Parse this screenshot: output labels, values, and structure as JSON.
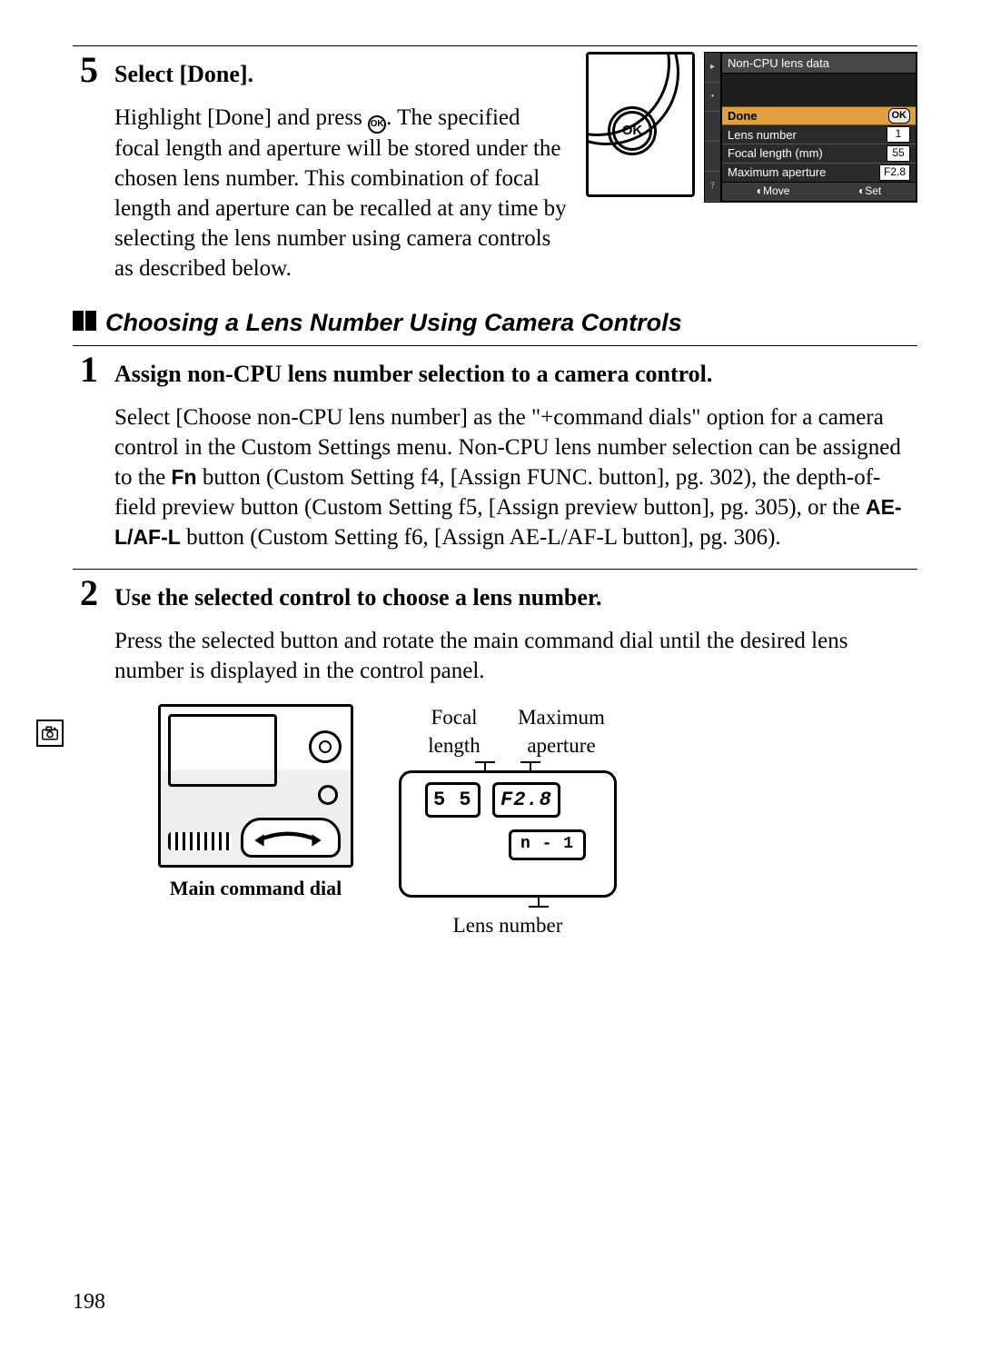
{
  "page_number": "198",
  "step5": {
    "num": "5",
    "title": "Select [Done].",
    "text_before_icon": "Highlight [Done] and press ",
    "text_after_icon": ". The specified focal length and aperture will be stored under the chosen lens number.  This combination of focal length and aperture can be recalled at any time by selecting the lens number using camera controls as described below.",
    "ok_btn_label": "OK"
  },
  "lcd": {
    "title": "Non-CPU lens data",
    "rows": {
      "done": "Done",
      "done_ok": "OK",
      "lens_number_label": "Lens number",
      "lens_number_val": "1",
      "focal_label": "Focal length (mm)",
      "focal_val": "55",
      "aperture_label": "Maximum aperture",
      "aperture_val": "F2.8"
    },
    "foot_move": "Move",
    "foot_set": "Set",
    "side_icons": [
      "▸",
      "•",
      "",
      "",
      "?"
    ]
  },
  "subheading": "Choosing a Lens Number Using Camera Controls",
  "step1": {
    "num": "1",
    "title": "Assign non-CPU lens number selection to a camera control.",
    "text1": "Select [Choose non-CPU lens number] as the \"+command dials\" option for a camera control in the Custom Settings menu.  Non-CPU lens number selection can be assigned to the ",
    "fn": "Fn",
    "text2": " button (Custom Setting f4, [Assign FUNC.  button], pg. 302), the depth-of-field preview button (Custom Setting f5, [Assign preview button], pg. 305), or the ",
    "ael": "AE-L/AF-L",
    "text3": " button (Custom Setting f6, [Assign AE-L/AF-L button], pg. 306)."
  },
  "step2": {
    "num": "2",
    "title": "Use the selected control to choose a lens number.",
    "text": "Press the selected button and rotate the main command dial until the desired lens number is displayed in the control panel."
  },
  "bottom": {
    "main_dial": "Main command dial",
    "focal_label_l1": "Focal",
    "focal_label_l2": "length",
    "aperture_label_l1": "Maximum",
    "aperture_label_l2": "aperture",
    "seg_focal": "5 5",
    "seg_aperture": "F2.8",
    "seg_lens": "n - 1",
    "lens_number_label": "Lens number"
  }
}
